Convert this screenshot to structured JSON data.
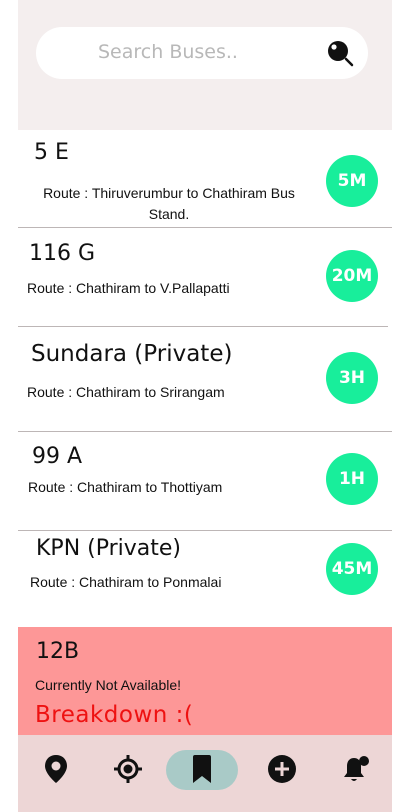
{
  "search": {
    "placeholder": "Search Buses.."
  },
  "buses": [
    {
      "number": "5 E",
      "route": "Route : Thiruverumbur to Chathiram Bus Stand.",
      "eta": "5M"
    },
    {
      "number": "116 G",
      "route": "Route : Chathiram to V.Pallapatti",
      "eta": "20M"
    },
    {
      "number": "Sundara  (Private)",
      "route": "Route : Chathiram to Srirangam",
      "eta": "3H"
    },
    {
      "number": "99 A",
      "route": "Route : Chathiram to Thottiyam",
      "eta": "1H"
    },
    {
      "number": "KPN (Private)",
      "route": "Route : Chathiram to Ponmalai",
      "eta": "45M"
    }
  ],
  "unavailable": {
    "number": "12B",
    "status": "Currently Not Available!",
    "reason": "Breakdown  :("
  },
  "nav": {
    "items": [
      "location-pin-icon",
      "gps-target-icon",
      "bookmark-icon",
      "add-circle-icon",
      "notification-bell-icon"
    ],
    "active_index": 2
  },
  "colors": {
    "eta_badge": "#18ee9b",
    "unavailable_bg": "#fd9797",
    "breakdown_text": "#ee1111",
    "nav_bg": "#edd6d6",
    "nav_active": "#a9cac7"
  }
}
